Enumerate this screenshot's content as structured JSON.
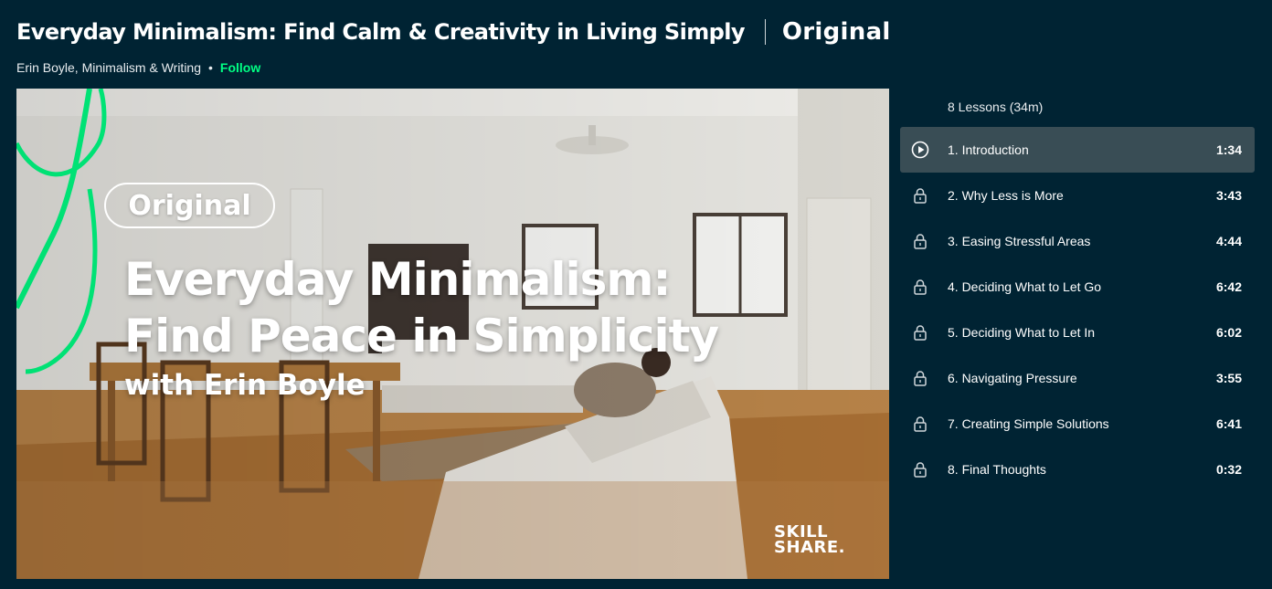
{
  "header": {
    "title": "Everyday Minimalism: Find Calm & Creativity in Living Simply",
    "original_label": "Original",
    "teacher": "Erin Boyle, Minimalism & Writing",
    "separator": "•",
    "follow_label": "Follow"
  },
  "video": {
    "badge": "Original",
    "title_line1": "Everyday Minimalism:",
    "title_line2": "Find Peace in Simplicity",
    "subtitle": "with Erin Boyle",
    "watermark_line1": "SKILL",
    "watermark_line2": "SHARE."
  },
  "lessons": {
    "count_label": "8 Lessons (34m)",
    "items": [
      {
        "title": "1. Introduction",
        "duration": "1:34",
        "icon": "play-icon",
        "active": true
      },
      {
        "title": "2. Why Less is More",
        "duration": "3:43",
        "icon": "lock-icon"
      },
      {
        "title": "3. Easing Stressful Areas",
        "duration": "4:44",
        "icon": "lock-icon"
      },
      {
        "title": "4. Deciding What to Let Go",
        "duration": "6:42",
        "icon": "lock-icon"
      },
      {
        "title": "5. Deciding What to Let In",
        "duration": "6:02",
        "icon": "lock-icon"
      },
      {
        "title": "6. Navigating Pressure",
        "duration": "3:55",
        "icon": "lock-icon"
      },
      {
        "title": "7. Creating Simple Solutions",
        "duration": "6:41",
        "icon": "lock-icon"
      },
      {
        "title": "8. Final Thoughts",
        "duration": "0:32",
        "icon": "lock-icon"
      }
    ]
  },
  "colors": {
    "background": "#002333",
    "accent": "#00ff84",
    "active_row": "#394d55"
  }
}
